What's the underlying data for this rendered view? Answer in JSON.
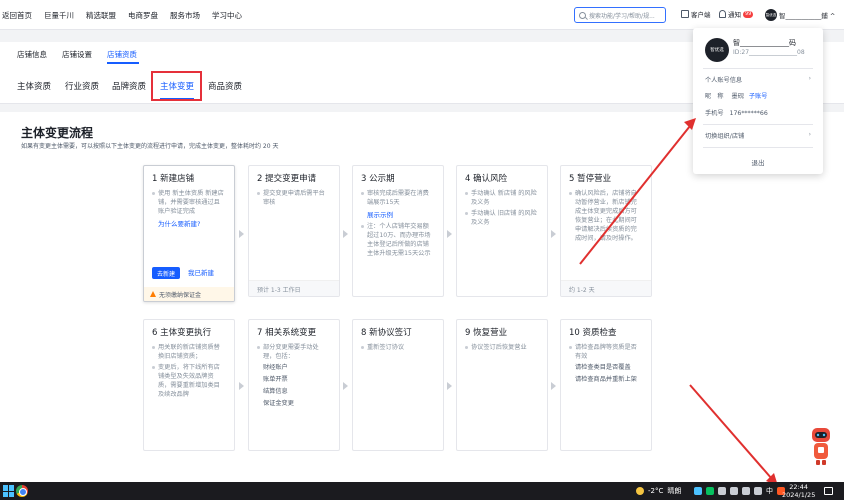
{
  "topnav": {
    "items": [
      "返回首页",
      "巨量千川",
      "精选联盟",
      "电商罗盘",
      "服务市场",
      "学习中心"
    ],
    "search_placeholder": "搜索功能/学习/帮助/规...",
    "service_label": "客户端",
    "notice_label": "通知",
    "notice_badge": "99",
    "user_name": "智___________鋪 ^",
    "avatar_text": "智优选"
  },
  "subtabs": {
    "items": [
      "店铺信息",
      "店铺设置",
      "店铺资质"
    ],
    "active": "店铺资质"
  },
  "restabs": {
    "items": [
      "主体资质",
      "行业资质",
      "品牌资质",
      "主体变更",
      "商品资质"
    ],
    "active": "主体变更"
  },
  "main": {
    "title": "主体变更流程",
    "description": "如果有变更主体需要，可以按照以下主体变更的流程进行申请，完成主体变更，整体耗时约 20 天"
  },
  "steps": [
    {
      "title": "1 新建店铺",
      "items": [
        "使用 新主体资质 新建店铺，并需要审核通过且账户验证完成"
      ],
      "link": "为什么要新建?",
      "button_primary": "去新建",
      "button_link": "我已新建",
      "warning": "无须缴纳保证金"
    },
    {
      "title": "2 提交变更申请",
      "items": [
        "提交变更申请后需平台审核"
      ],
      "footer": "预计 1-3 工作日"
    },
    {
      "title": "3 公示期",
      "items": [
        "审核完成后需要在消费端展示15天"
      ],
      "link": "展示示例",
      "note": "注：个人店铺年交易额超过10万、而办理市场主体登记后所做的店铺主体升级无需15天公示"
    },
    {
      "title": "4 确认风险",
      "items": [
        "手动确认 新店铺 的风险及义务",
        "手动确认 旧店铺 的风险及义务"
      ]
    },
    {
      "title": "5 暂停营业",
      "items": [
        "确认风险后，店铺将自动暂停营业，新店铺完成主体变更完成后方可恢复营业；在此期间可申请解决后续资质的完成时间，请及时操作。"
      ],
      "footer": "约 1-2 天"
    },
    {
      "title": "6 主体变更执行",
      "items": [
        "用关联的新店铺资质替换旧店铺资质；",
        "变更后，将下线所有店铺类型及失效品牌资质，需要重新增加类目及续改品牌"
      ]
    },
    {
      "title": "7 相关系统变更",
      "items": [
        "部分变更需要手动处理，包括："
      ],
      "subs": [
        "财经账户",
        "账单开票",
        "结算信息",
        "保证金变更"
      ]
    },
    {
      "title": "8 新协议签订",
      "items": [
        "重新签订协议"
      ]
    },
    {
      "title": "9 恢复营业",
      "items": [
        "协议签订后恢复营业"
      ]
    },
    {
      "title": "10 资质检查",
      "items": [
        "请检查品牌等资质是否有效",
        "请检查类目是否覆盖",
        "请检查商品并重新上架"
      ]
    }
  ],
  "dropdown": {
    "avatar_text": "智优选",
    "name": "智______________码",
    "id": "ID:27________________08",
    "account_info": "个人账号信息",
    "nick_label": "昵　称",
    "nick_value": "墨砚",
    "sub_account": "子账号",
    "phone_label": "手机号",
    "phone_value": "176******66",
    "switch_org": "切换组织/店铺",
    "logout": "退出"
  },
  "taskbar": {
    "temperature": "-2°C",
    "weather": "晴朗",
    "ime": "中",
    "time": "22:44",
    "date": "2024/1/25"
  },
  "colors": {
    "accent": "#165dff",
    "highlight_box": "#e5303a",
    "annotation_arrow": "#e0302f",
    "warning": "#ff7d00"
  }
}
